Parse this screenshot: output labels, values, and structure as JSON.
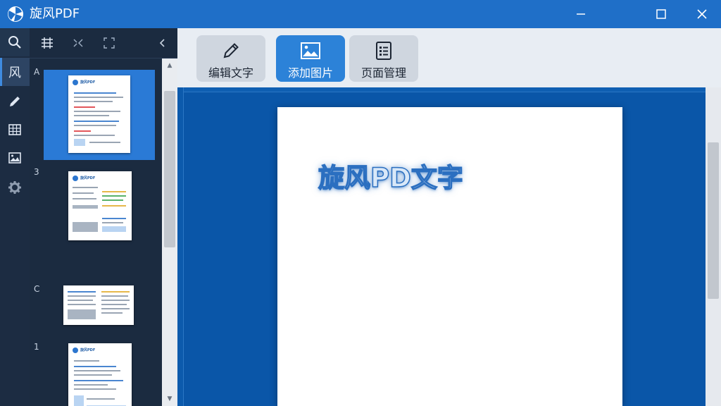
{
  "window": {
    "title": "旋风PDF",
    "colors": {
      "titlebar": "#1f6fc8",
      "active_tool": "#2c82d8",
      "canvas": "#0a56a8"
    }
  },
  "rail": {
    "items": [
      {
        "icon": "search-icon"
      },
      {
        "label": "风"
      },
      {
        "icon": "pencil-icon"
      },
      {
        "icon": "table-icon"
      },
      {
        "icon": "image-icon"
      },
      {
        "icon": "gear-icon"
      }
    ]
  },
  "thumbs": {
    "items": [
      {
        "num": "A",
        "heading": "旋风PDF"
      },
      {
        "num": "3",
        "heading": "旋风PDF"
      },
      {
        "num": "C",
        "heading": ""
      },
      {
        "num": "1",
        "heading": "旋风PDF"
      }
    ]
  },
  "toolbar": {
    "buttons": [
      {
        "label": "编辑文字",
        "icon": "pencil-icon",
        "active": false
      },
      {
        "label": "添加图片",
        "icon": "image-icon",
        "active": true
      },
      {
        "label": "页面管理",
        "icon": "list-icon",
        "active": false
      }
    ]
  },
  "document": {
    "text": "旋风PD文字"
  }
}
